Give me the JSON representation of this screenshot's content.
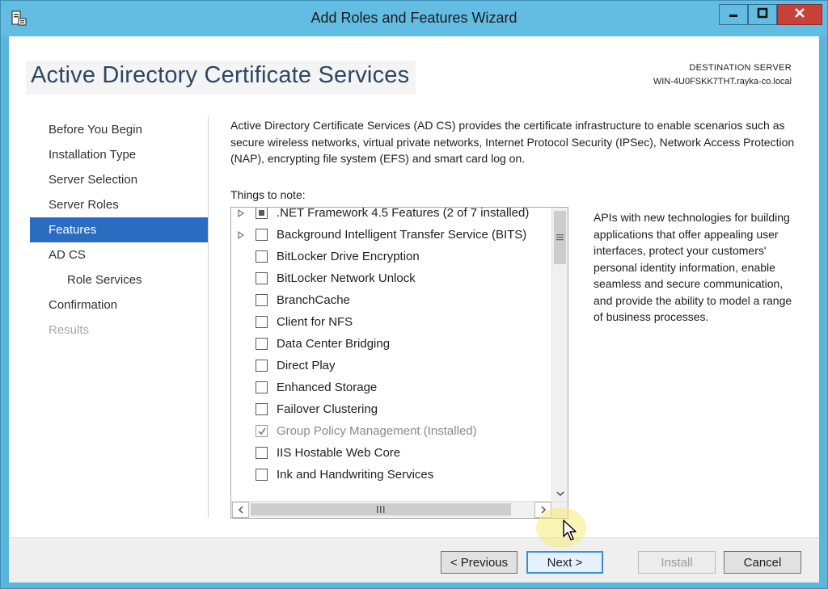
{
  "window": {
    "title": "Add Roles and Features Wizard",
    "minimize_icon": "minimize-icon",
    "maximize_icon": "maximize-icon",
    "close_icon": "close-icon"
  },
  "header": {
    "page_title": "Active Directory Certificate Services",
    "destination_label": "DESTINATION SERVER",
    "destination_server": "WIN-4U0FSKK7THT.rayka-co.local"
  },
  "nav": {
    "items": [
      {
        "label": "Before You Begin",
        "state": "normal"
      },
      {
        "label": "Installation Type",
        "state": "normal"
      },
      {
        "label": "Server Selection",
        "state": "normal"
      },
      {
        "label": "Server Roles",
        "state": "normal"
      },
      {
        "label": "Features",
        "state": "active"
      },
      {
        "label": "AD CS",
        "state": "normal"
      },
      {
        "label": "Role Services",
        "state": "sub"
      },
      {
        "label": "Confirmation",
        "state": "normal"
      },
      {
        "label": "Results",
        "state": "disabled"
      }
    ]
  },
  "content": {
    "intro": "Active Directory Certificate Services (AD CS) provides the certificate infrastructure to enable scenarios such as secure wireless networks, virtual private networks, Internet Protocol Security (IPSec), Network Access Protection (NAP), encrypting file system (EFS) and smart card log on.",
    "things_to_note": "Things to note:",
    "features": [
      {
        "label": ".NET Framework 4.5 Features (2 of 7 installed)",
        "expandable": true,
        "check": "partial"
      },
      {
        "label": "Background Intelligent Transfer Service (BITS)",
        "expandable": true,
        "check": "unchecked"
      },
      {
        "label": "BitLocker Drive Encryption",
        "expandable": false,
        "check": "unchecked"
      },
      {
        "label": "BitLocker Network Unlock",
        "expandable": false,
        "check": "unchecked"
      },
      {
        "label": "BranchCache",
        "expandable": false,
        "check": "unchecked"
      },
      {
        "label": "Client for NFS",
        "expandable": false,
        "check": "unchecked"
      },
      {
        "label": "Data Center Bridging",
        "expandable": false,
        "check": "unchecked"
      },
      {
        "label": "Direct Play",
        "expandable": false,
        "check": "unchecked"
      },
      {
        "label": "Enhanced Storage",
        "expandable": false,
        "check": "unchecked"
      },
      {
        "label": "Failover Clustering",
        "expandable": false,
        "check": "unchecked"
      },
      {
        "label": "Group Policy Management (Installed)",
        "expandable": false,
        "check": "checked"
      },
      {
        "label": "IIS Hostable Web Core",
        "expandable": false,
        "check": "unchecked"
      },
      {
        "label": "Ink and Handwriting Services",
        "expandable": false,
        "check": "unchecked"
      }
    ],
    "description": "APIs with new technologies for building applications that offer appealing user interfaces, protect your customers' personal identity information, enable seamless and secure communication, and provide the ability to model a range of business processes."
  },
  "footer": {
    "previous": "< Previous",
    "next": "Next >",
    "install": "Install",
    "cancel": "Cancel"
  },
  "colors": {
    "window_frame": "#63bde3",
    "nav_active": "#2a6cbf",
    "close_button": "#c7403a"
  }
}
